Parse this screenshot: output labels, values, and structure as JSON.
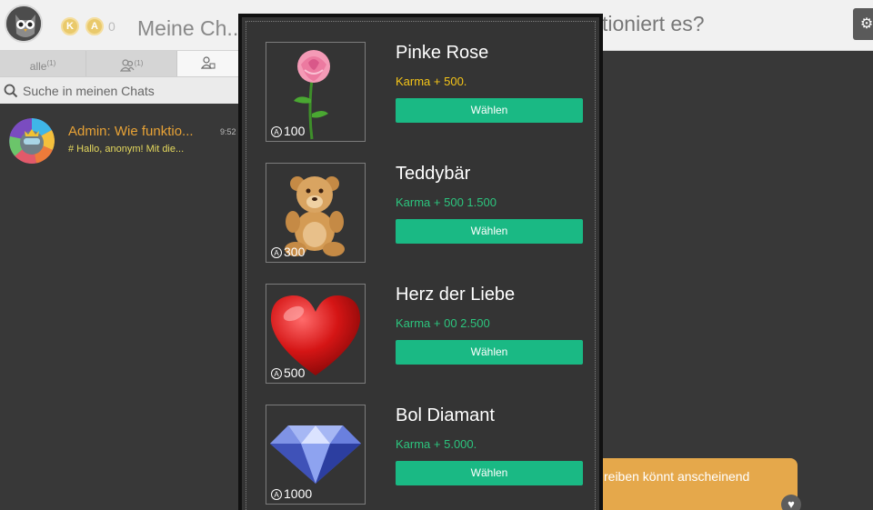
{
  "header": {
    "title": "Meine Ch..",
    "right_title": "tioniert es?",
    "karma_coin": "K",
    "a_coin": "A",
    "coin_count": "0"
  },
  "tabs": [
    {
      "label": "alle",
      "count": "(1)"
    },
    {
      "label": "",
      "count": "(1)"
    },
    {
      "label": "",
      "count": ""
    }
  ],
  "search": {
    "placeholder": "Suche in meinen Chats"
  },
  "chat": {
    "name": "Admin: Wie funktio...",
    "time": "9:52",
    "preview": "# Hallo, anonym! Mit die..."
  },
  "bubble": {
    "text": "reiben könnt anscheinend"
  },
  "gifts": [
    {
      "name": "Pinke Rose",
      "karma": "Karma + 500.",
      "karma_color": "#f5c518",
      "price": "100",
      "button": "Wählen",
      "icon": "rose-icon"
    },
    {
      "name": "Teddybär",
      "karma": "Karma + 500 1.500",
      "karma_color": "#2cc57e",
      "price": "300",
      "button": "Wählen",
      "icon": "teddy-bear-icon"
    },
    {
      "name": "Herz der Liebe",
      "karma": "Karma + 00 2.500",
      "karma_color": "#2cc57e",
      "price": "500",
      "button": "Wählen",
      "icon": "heart-icon"
    },
    {
      "name": "Bol Diamant",
      "karma": "Karma + 5.000.",
      "karma_color": "#2cc57e",
      "price": "1000",
      "button": "Wählen",
      "icon": "diamond-icon"
    }
  ],
  "colors": {
    "accent": "#1ab984",
    "karma_gold": "#f5c518",
    "karma_green": "#2cc57e"
  }
}
